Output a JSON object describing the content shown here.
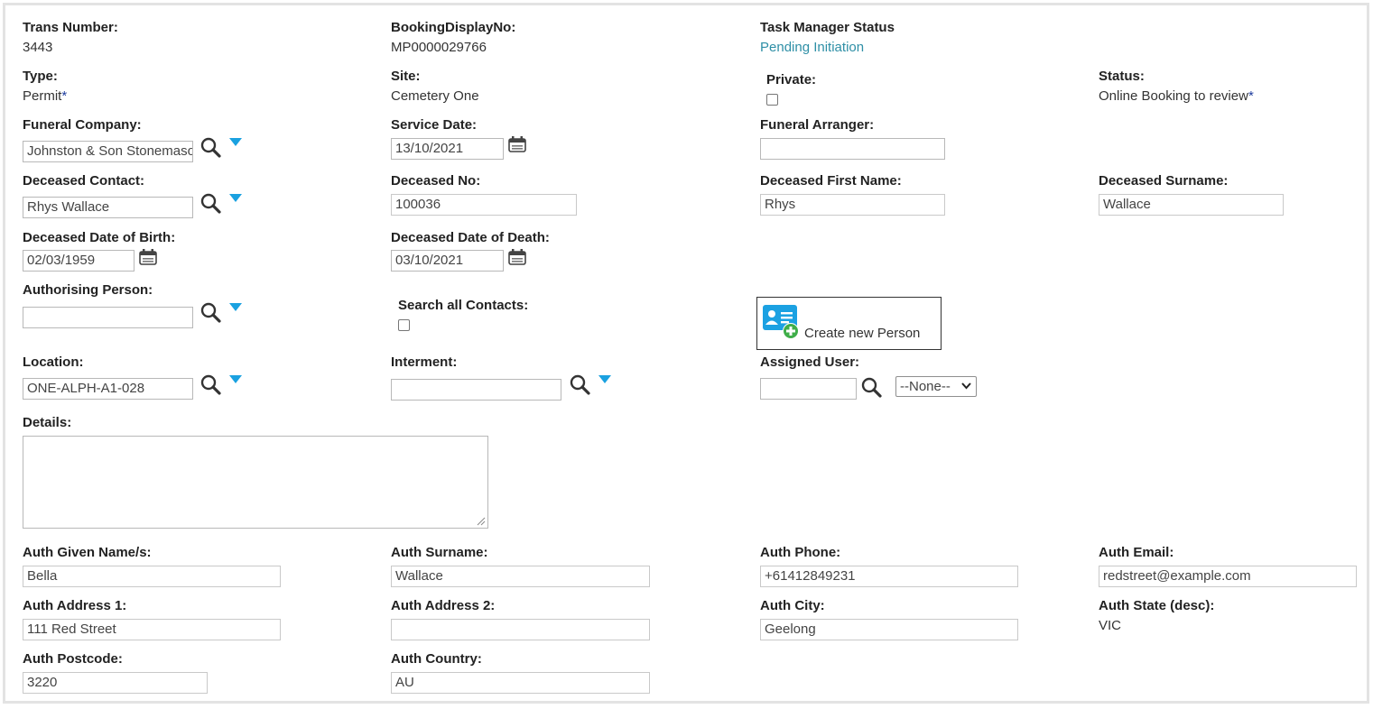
{
  "header": {
    "trans_number": {
      "label": "Trans Number:",
      "value": "3443"
    },
    "booking_display_no": {
      "label": "BookingDisplayNo:",
      "value": "MP0000029766"
    },
    "task_manager_status": {
      "label": "Task Manager Status",
      "value": "Pending Initiation"
    }
  },
  "row_type": {
    "type": {
      "label": "Type:",
      "value": "Permit",
      "required_mark": "*"
    },
    "site": {
      "label": "Site:",
      "value": "Cemetery One"
    },
    "private": {
      "label": "Private:",
      "checked": false
    },
    "status": {
      "label": "Status:",
      "value": "Online Booking to review",
      "required_mark": "*"
    }
  },
  "row_funeral": {
    "funeral_company": {
      "label": "Funeral Company:",
      "value": "Johnston & Son Stonemasons"
    },
    "service_date": {
      "label": "Service Date:",
      "value": "13/10/2021"
    },
    "funeral_arranger": {
      "label": "Funeral Arranger:",
      "value": ""
    }
  },
  "row_deceased": {
    "deceased_contact": {
      "label": "Deceased Contact:",
      "value": "Rhys Wallace"
    },
    "deceased_no": {
      "label": "Deceased No:",
      "value": "100036"
    },
    "deceased_first_name": {
      "label": "Deceased First Name:",
      "value": "Rhys"
    },
    "deceased_surname": {
      "label": "Deceased Surname:",
      "value": "Wallace"
    }
  },
  "row_dates": {
    "dob": {
      "label": "Deceased Date of Birth:",
      "value": "02/03/1959"
    },
    "dod": {
      "label": "Deceased Date of Death:",
      "value": "03/10/2021"
    }
  },
  "row_auth_person": {
    "authorising_person": {
      "label": "Authorising Person:",
      "value": ""
    },
    "search_all_contacts": {
      "label": "Search all Contacts:",
      "checked": false
    },
    "create_new_person": {
      "label": "Create new Person"
    }
  },
  "row_location": {
    "location": {
      "label": "Location:",
      "value": "ONE-ALPH-A1-028"
    },
    "interment": {
      "label": "Interment:",
      "value": ""
    },
    "assigned_user": {
      "label": "Assigned User:",
      "value": "",
      "select_value": "--None--"
    }
  },
  "details": {
    "label": "Details:",
    "value": ""
  },
  "auth": {
    "given_names": {
      "label": "Auth Given Name/s:",
      "value": "Bella"
    },
    "surname": {
      "label": "Auth Surname:",
      "value": "Wallace"
    },
    "phone": {
      "label": "Auth Phone:",
      "value": "+61412849231"
    },
    "email": {
      "label": "Auth Email:",
      "value": "redstreet@example.com"
    },
    "address1": {
      "label": "Auth Address 1:",
      "value": "111 Red Street"
    },
    "address2": {
      "label": "Auth Address 2:",
      "value": ""
    },
    "city": {
      "label": "Auth City:",
      "value": "Geelong"
    },
    "state": {
      "label": "Auth State (desc):",
      "value": "VIC"
    },
    "postcode": {
      "label": "Auth Postcode:",
      "value": "3220"
    },
    "country": {
      "label": "Auth Country:",
      "value": "AU"
    }
  },
  "colors": {
    "link": "#2e8fa6",
    "required_mark": "#1f3d9e",
    "dropdown_arrow": "#1aa1e0",
    "create_person_icon": "#1ba1e2",
    "create_person_plus": "#3fae49"
  },
  "icons": {
    "search": "search-icon",
    "dropdown": "dropdown-arrow-icon",
    "calendar": "calendar-icon",
    "create_person": "contact-card-add-icon"
  }
}
